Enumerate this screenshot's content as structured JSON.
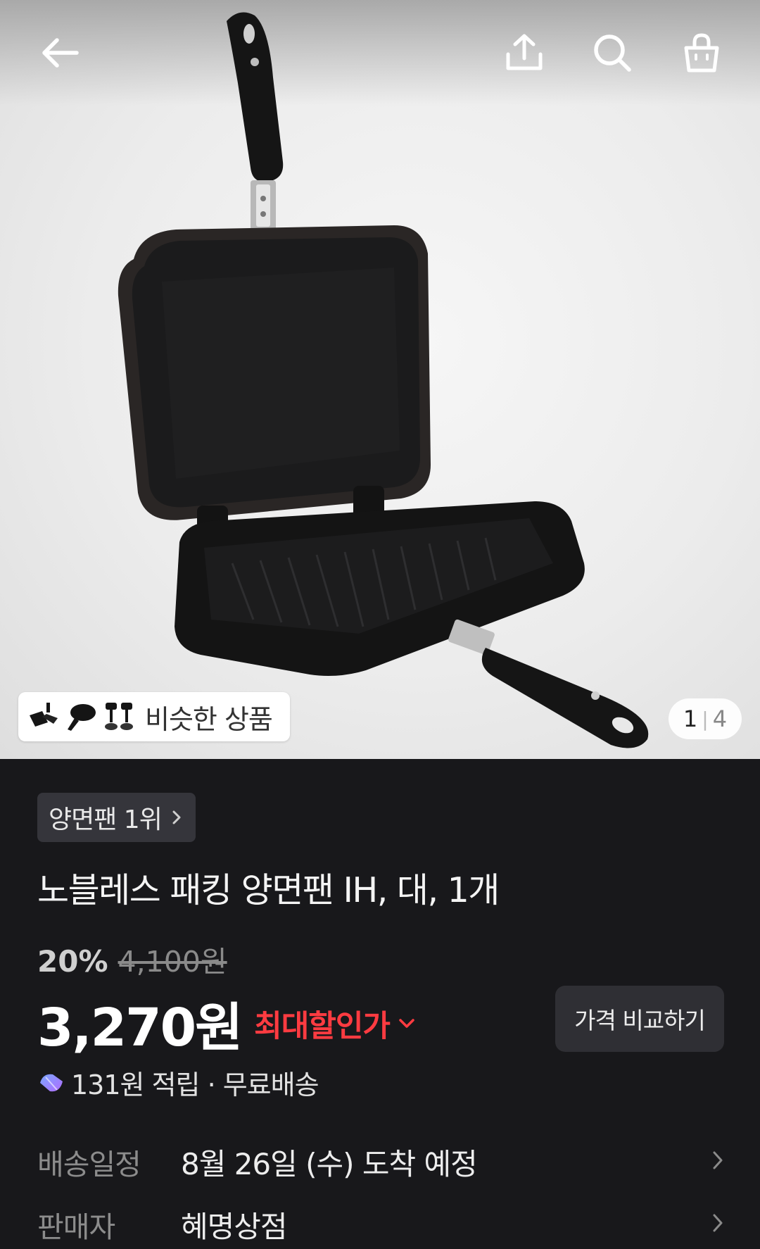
{
  "header": {
    "back_icon": "arrow-left-icon",
    "share_icon": "share-upload-icon",
    "search_icon": "search-icon",
    "cart_icon": "shopping-bag-icon"
  },
  "gallery": {
    "similar_label": "비슷한 상품",
    "current": "1",
    "total": "4"
  },
  "product": {
    "rank_badge": "양면팬 1위",
    "title": "노블레스 패킹 양면팬 IH, 대, 1개",
    "discount_percent": "20%",
    "original_price": "4,100원",
    "price": "3,270원",
    "max_discount_label": "최대할인가",
    "compare_button": "가격 비교하기",
    "reward_text": "131원 적립 · 무료배송"
  },
  "details": [
    {
      "label": "배송일정",
      "value": "8월 26일 (수) 도착 예정"
    },
    {
      "label": "판매자",
      "value": "혜명상점"
    }
  ],
  "colors": {
    "background": "#18181b",
    "accent_red": "#ff3b41",
    "badge_bg": "#35353b"
  }
}
